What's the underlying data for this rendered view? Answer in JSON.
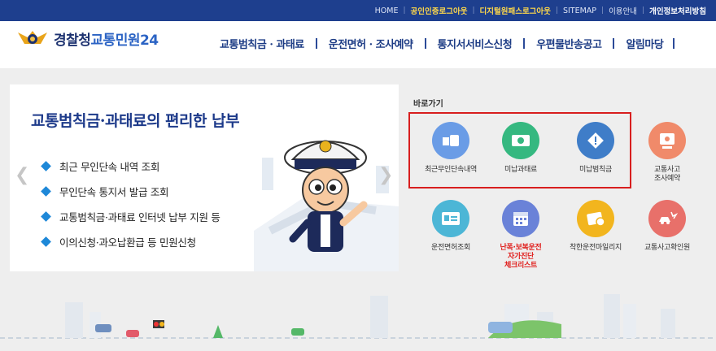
{
  "utility_nav": [
    {
      "label": "HOME",
      "style": "normal"
    },
    {
      "label": "공인인증로그아웃",
      "style": "hl"
    },
    {
      "label": "디지털원패스로그아웃",
      "style": "hl"
    },
    {
      "label": "SITEMAP",
      "style": "normal"
    },
    {
      "label": "이용안내",
      "style": "normal"
    },
    {
      "label": "개인정보처리방침",
      "style": "bold"
    }
  ],
  "logo": {
    "part1": "경찰청",
    "part2": "교통민원24"
  },
  "gnb": [
    "교통범칙금 · 과태료",
    "운전면허 · 조사예약",
    "통지서서비스신청",
    "우편물반송공고",
    "알림마당"
  ],
  "slide": {
    "headline": "교통범칙금·과태료의 편리한 납부",
    "items": [
      "최근 무인단속 내역 조회",
      "무인단속 통지서 발급 조회",
      "교통범칙금·과태료 인터넷 납부 지원 등",
      "이의신청·과오납환급 등 민원신청"
    ]
  },
  "quick": {
    "title": "바로가기",
    "items": [
      {
        "id": "recent",
        "label": "최근무인단속내역",
        "icon": "camera-icon",
        "color": "#6a9ce6"
      },
      {
        "id": "unpaid-fine",
        "label": "미납과태료",
        "icon": "money-icon",
        "color": "#35b880"
      },
      {
        "id": "unpaid-penalty",
        "label": "미납범칙금",
        "icon": "warning-sign-icon",
        "color": "#3f7dc8"
      },
      {
        "id": "accident-reservation",
        "label": "교통사고\n조사예약",
        "icon": "monitor-icon",
        "color": "#f08a6a"
      },
      {
        "id": "license",
        "label": "운전면허조회",
        "icon": "id-card-icon",
        "color": "#4cb6d6"
      },
      {
        "id": "checklist",
        "label": "난폭·보복운전\n자가진단\n체크리스트",
        "icon": "calendar-icon",
        "color": "#6a82d8",
        "red": true
      },
      {
        "id": "mileage",
        "label": "착한운전마일리지",
        "icon": "mileage-card-icon",
        "color": "#f2b51e"
      },
      {
        "id": "accident-check",
        "label": "교통사고확인원",
        "icon": "car-crash-icon",
        "color": "#e8706a"
      }
    ]
  },
  "slider_state": {
    "total": 2,
    "current": 1
  },
  "colors": {
    "brand": "#1e3f8e",
    "highlight": "#d81e1e"
  }
}
